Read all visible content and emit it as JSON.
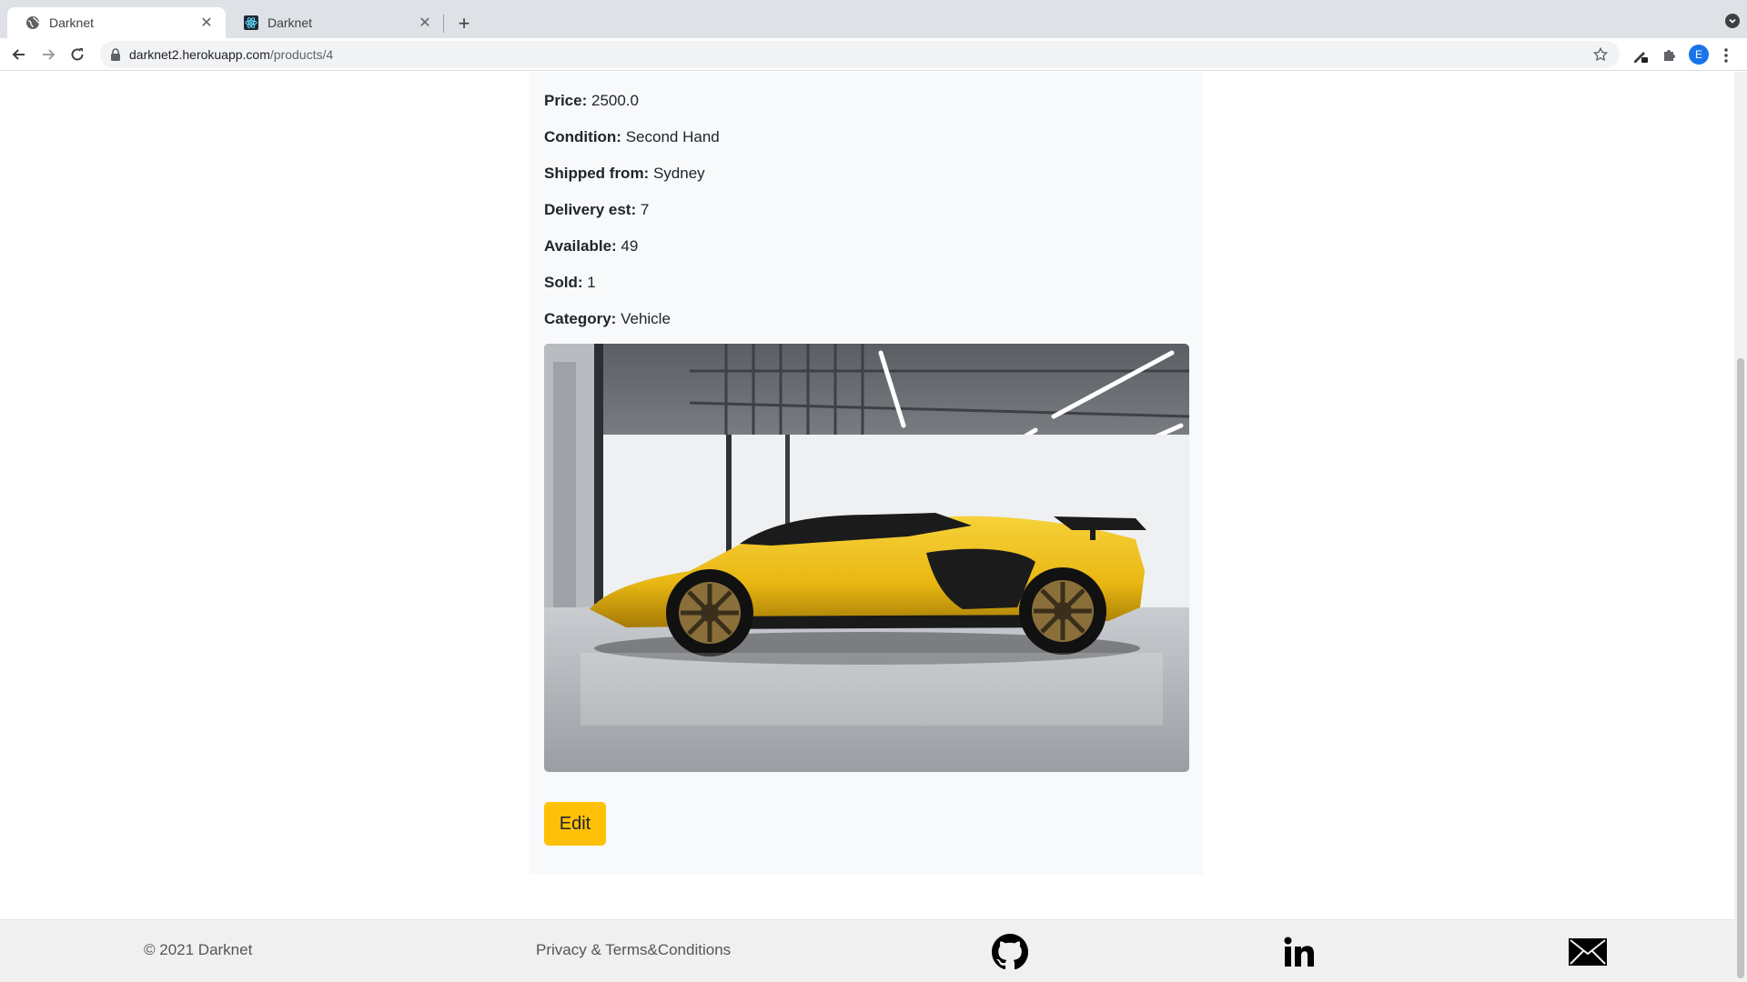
{
  "browser": {
    "tabs": [
      {
        "title": "Darknet",
        "active": true
      },
      {
        "title": "Darknet",
        "active": false
      }
    ],
    "url_host": "darknet2.herokuapp.com",
    "url_path": "/products/4",
    "profile_initial": "E"
  },
  "product": {
    "fields": [
      {
        "label": "Price:",
        "value": "2500.0"
      },
      {
        "label": "Condition:",
        "value": "Second Hand"
      },
      {
        "label": "Shipped from:",
        "value": "Sydney"
      },
      {
        "label": "Delivery est:",
        "value": "7"
      },
      {
        "label": "Available:",
        "value": "49"
      },
      {
        "label": "Sold:",
        "value": "1"
      },
      {
        "label": "Category:",
        "value": "Vehicle"
      }
    ],
    "edit_label": "Edit"
  },
  "footer": {
    "copyright": "© 2021 Darknet",
    "privacy": "Privacy & Terms&Conditions",
    "icons": [
      "github-icon",
      "linkedin-icon",
      "mail-icon"
    ]
  },
  "colors": {
    "accent": "#ffc107",
    "card_bg": "#f8f9fa",
    "footer_bg": "#f0f0f0",
    "car_yellow": "#f2c21b"
  }
}
